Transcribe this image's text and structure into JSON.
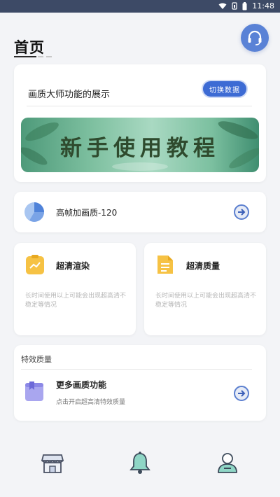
{
  "status_bar": {
    "time": "11:48",
    "icons": [
      "wifi-icon",
      "signal-icon",
      "battery-icon"
    ]
  },
  "header": {
    "title": "首页",
    "support_icon": "headset-icon"
  },
  "showcase": {
    "title": "画质大师功能的展示",
    "switch_button": "切换数据",
    "banner_text": "新手使用教程"
  },
  "hf_item": {
    "label": "高帧加画质-120"
  },
  "features": [
    {
      "title": "超清渲染",
      "desc": "长时间使用以上可能会出现超高清不稳定等情况"
    },
    {
      "title": "超清质量",
      "desc": "长时间使用以上可能会出现超高清不稳定等情况"
    }
  ],
  "effect": {
    "section_label": "特效质量",
    "title": "更多画质功能",
    "desc": "点击开启超高清特效质量"
  },
  "bottom_nav": [
    {
      "icon": "store-icon"
    },
    {
      "icon": "bell-icon"
    },
    {
      "icon": "profile-icon"
    }
  ],
  "colors": {
    "accent": "#3d6bd4",
    "status_bar": "#3d4a66",
    "pie": "#5b8ddf",
    "amber": "#f6c244"
  }
}
